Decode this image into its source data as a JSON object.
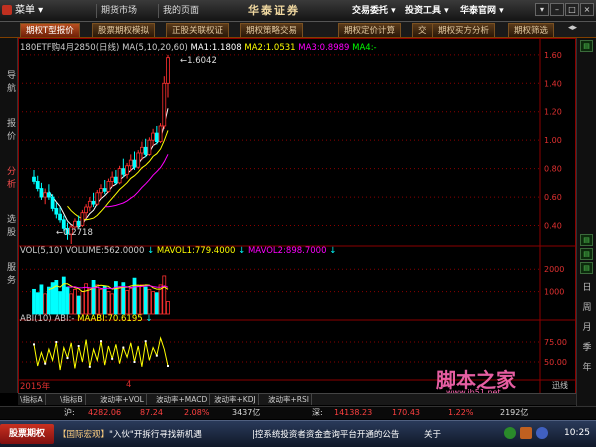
{
  "titlebar": {
    "menu_label": "菜单",
    "nav": [
      "期货市场",
      "我的页面"
    ],
    "brand": "华泰证券",
    "menus": [
      "交易委托",
      "投资工具",
      "华泰官网"
    ],
    "window_buttons": [
      "▾",
      "–",
      "□",
      "×"
    ]
  },
  "tabs": [
    "期权T型报价",
    "股票期权模拟",
    "正股关联权证",
    "期权策略交易",
    "期权定价计算",
    "交",
    "期权买方分析",
    "期权筛选"
  ],
  "active_tab": 0,
  "sidebar": {
    "items": [
      "导航",
      "报价",
      "分析",
      "选股",
      "服务"
    ],
    "active": 2
  },
  "right_sidebar": {
    "labels": [
      "日",
      "周",
      "月",
      "季",
      "年"
    ]
  },
  "chart": {
    "title": "180ETF购4月2850(日线)",
    "ma_label": "MA(5,10,20,60)",
    "ma1": "MA1:1.1808",
    "ma2": "MA2:1.0531",
    "ma3": "MA3:0.8989",
    "ma4": "MA4:-",
    "high_label": "1.6042",
    "low_label": "0.2718",
    "volume_title": "VOL(5,10)",
    "volume_value": "VOLUME:562.0000",
    "mavol1": "MAVOL1:779.4000",
    "mavol2": "MAVOL2:898.7000",
    "abi_title": "ABI(10)",
    "abi_value": "ABI:-",
    "maabi": "MAABI:70.6195",
    "year_label": "2015年",
    "month_label": "4",
    "trail_label": "迅线",
    "watermark_cn": "脚本之家",
    "watermark_url": "www.jb51.net"
  },
  "colors": {
    "ma1": "#ffffff",
    "ma2": "#ffff00",
    "ma3": "#ff00ff",
    "ma4": "#00ff00",
    "up": "#ff3030",
    "down": "#00ffff",
    "grid": "#8b0000",
    "watermark": "#ff69b4"
  },
  "chart_data": {
    "type": "candlestick",
    "price_axis": [
      "1.60",
      "1.40",
      "1.20",
      "1.00",
      "0.80",
      "0.60",
      "0.40"
    ],
    "price_range": [
      0.27,
      1.62
    ],
    "volume_axis": [
      "2000",
      "1000"
    ],
    "volume_range": [
      0,
      2500
    ],
    "abi_axis": [
      "75.00",
      "50.00"
    ],
    "abi_range": [
      30,
      95
    ],
    "candles": [
      {
        "o": 0.74,
        "h": 0.79,
        "l": 0.69,
        "c": 0.71
      },
      {
        "o": 0.71,
        "h": 0.75,
        "l": 0.64,
        "c": 0.66
      },
      {
        "o": 0.66,
        "h": 0.7,
        "l": 0.58,
        "c": 0.6
      },
      {
        "o": 0.6,
        "h": 0.66,
        "l": 0.55,
        "c": 0.63
      },
      {
        "o": 0.63,
        "h": 0.69,
        "l": 0.58,
        "c": 0.6
      },
      {
        "o": 0.6,
        "h": 0.62,
        "l": 0.5,
        "c": 0.52
      },
      {
        "o": 0.52,
        "h": 0.56,
        "l": 0.45,
        "c": 0.48
      },
      {
        "o": 0.48,
        "h": 0.53,
        "l": 0.42,
        "c": 0.44
      },
      {
        "o": 0.44,
        "h": 0.47,
        "l": 0.36,
        "c": 0.38
      },
      {
        "o": 0.38,
        "h": 0.42,
        "l": 0.3,
        "c": 0.34
      },
      {
        "o": 0.34,
        "h": 0.4,
        "l": 0.27,
        "c": 0.39
      },
      {
        "o": 0.39,
        "h": 0.45,
        "l": 0.37,
        "c": 0.43
      },
      {
        "o": 0.43,
        "h": 0.47,
        "l": 0.38,
        "c": 0.4
      },
      {
        "o": 0.4,
        "h": 0.51,
        "l": 0.39,
        "c": 0.49
      },
      {
        "o": 0.49,
        "h": 0.55,
        "l": 0.45,
        "c": 0.53
      },
      {
        "o": 0.53,
        "h": 0.6,
        "l": 0.5,
        "c": 0.57
      },
      {
        "o": 0.57,
        "h": 0.63,
        "l": 0.53,
        "c": 0.55
      },
      {
        "o": 0.55,
        "h": 0.65,
        "l": 0.54,
        "c": 0.63
      },
      {
        "o": 0.63,
        "h": 0.69,
        "l": 0.59,
        "c": 0.66
      },
      {
        "o": 0.66,
        "h": 0.72,
        "l": 0.62,
        "c": 0.64
      },
      {
        "o": 0.64,
        "h": 0.73,
        "l": 0.63,
        "c": 0.71
      },
      {
        "o": 0.71,
        "h": 0.78,
        "l": 0.67,
        "c": 0.74
      },
      {
        "o": 0.74,
        "h": 0.79,
        "l": 0.69,
        "c": 0.7
      },
      {
        "o": 0.7,
        "h": 0.82,
        "l": 0.69,
        "c": 0.8
      },
      {
        "o": 0.8,
        "h": 0.87,
        "l": 0.74,
        "c": 0.76
      },
      {
        "o": 0.76,
        "h": 0.84,
        "l": 0.73,
        "c": 0.82
      },
      {
        "o": 0.82,
        "h": 0.9,
        "l": 0.78,
        "c": 0.86
      },
      {
        "o": 0.86,
        "h": 0.92,
        "l": 0.79,
        "c": 0.81
      },
      {
        "o": 0.81,
        "h": 0.93,
        "l": 0.8,
        "c": 0.91
      },
      {
        "o": 0.91,
        "h": 0.99,
        "l": 0.86,
        "c": 0.95
      },
      {
        "o": 0.95,
        "h": 1.01,
        "l": 0.88,
        "c": 0.9
      },
      {
        "o": 0.9,
        "h": 1.02,
        "l": 0.89,
        "c": 1.0
      },
      {
        "o": 1.0,
        "h": 1.08,
        "l": 0.96,
        "c": 1.05
      },
      {
        "o": 1.05,
        "h": 1.1,
        "l": 0.97,
        "c": 0.99
      },
      {
        "o": 0.99,
        "h": 1.12,
        "l": 0.98,
        "c": 1.1
      },
      {
        "o": 1.1,
        "h": 1.45,
        "l": 1.08,
        "c": 1.4
      },
      {
        "o": 1.4,
        "h": 1.6,
        "l": 1.3,
        "c": 1.58
      }
    ],
    "volume": [
      1100,
      950,
      1300,
      900,
      1200,
      1400,
      1500,
      1000,
      1650,
      1200,
      900,
      1100,
      800,
      1000,
      1350,
      1150,
      1500,
      1300,
      1100,
      1250,
      1000,
      900,
      1450,
      1200,
      1400,
      1050,
      1150,
      1600,
      1250,
      1300,
      1200,
      1100,
      1000,
      950,
      1300,
      1700,
      560
    ],
    "abi": [
      72,
      45,
      62,
      48,
      66,
      52,
      75,
      40,
      68,
      55,
      74,
      42,
      70,
      50,
      78,
      44,
      66,
      52,
      76,
      46,
      70,
      54,
      72,
      48,
      68,
      56,
      74,
      50,
      70,
      44,
      76,
      52,
      68,
      58,
      80,
      66,
      45
    ]
  },
  "bottom_tabs": [
    "\\指标A",
    "\\指标B",
    "波动率+VOL",
    "波动率+MACD",
    "波动率+KDJ",
    "波动率+RSI"
  ],
  "status": {
    "sh_label": "沪:",
    "sh_index": "4282.06",
    "sh_change": "87.24",
    "sh_pct": "2.08%",
    "sh_amount": "3437亿",
    "sz_label": "深:",
    "sz_index": "14138.23",
    "sz_change": "170.43",
    "sz_pct": "1.22%",
    "sz_amount": "2192亿"
  },
  "taskbar": {
    "start": "股票期权",
    "news_label": "【国际宏观】",
    "news_text": "\"入伙\"开拆行寻找新机遇",
    "announcement": "|控系统投资者资金查询平台开通的公告",
    "about": "关于",
    "clock": "10:25"
  }
}
